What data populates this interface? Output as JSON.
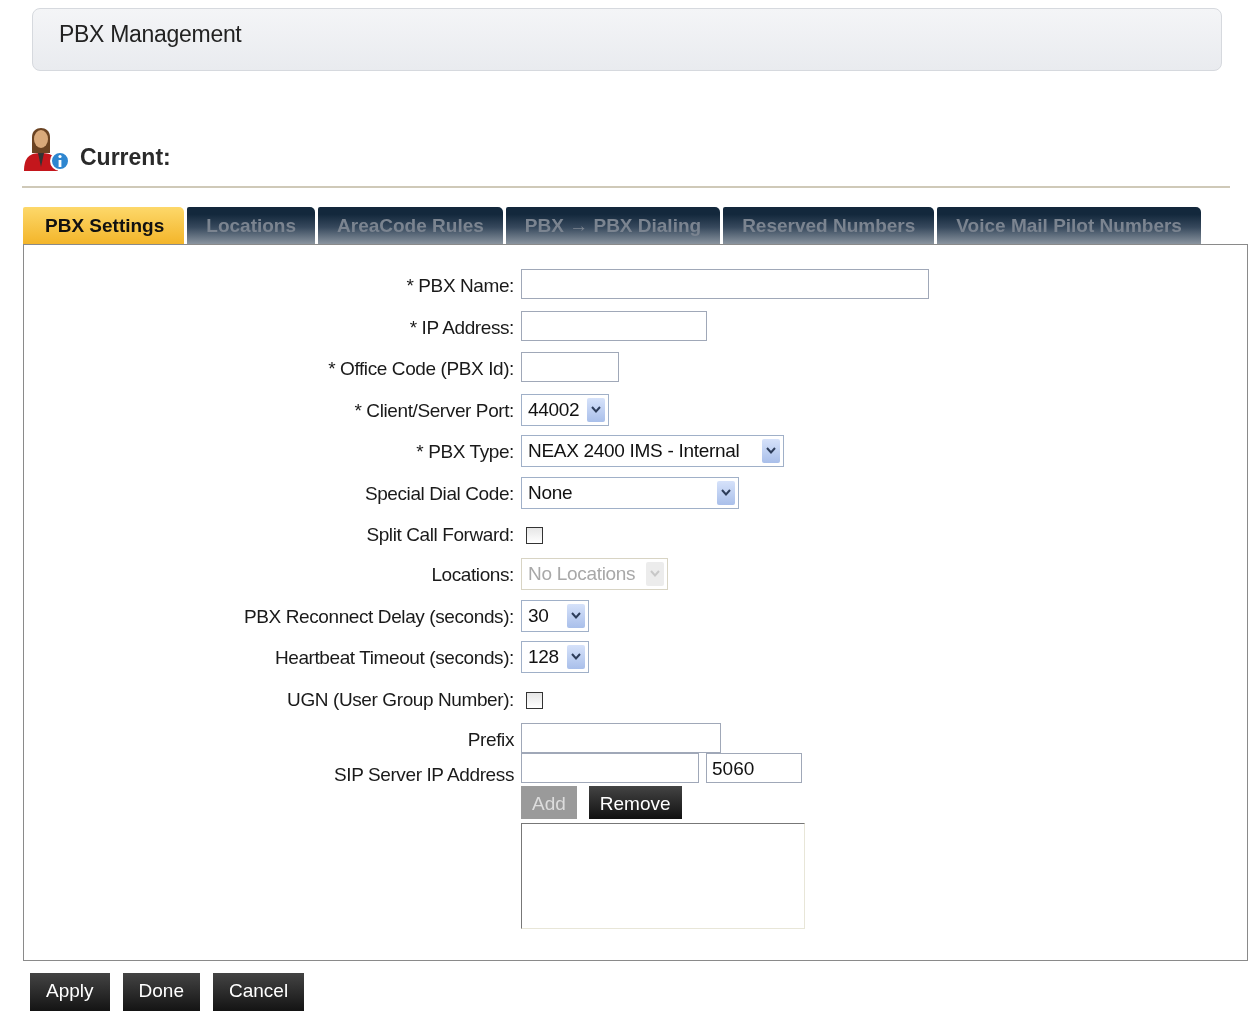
{
  "header": {
    "title": "PBX Management"
  },
  "section": {
    "title": "Current:"
  },
  "tabs": [
    {
      "label": "PBX Settings",
      "selected": true
    },
    {
      "label": "Locations",
      "selected": false
    },
    {
      "label": "AreaCode Rules",
      "selected": false
    },
    {
      "label": "PBX → PBX Dialing",
      "selected": false
    },
    {
      "label": "Reserved Numbers",
      "selected": false
    },
    {
      "label": "Voice Mail Pilot Numbers",
      "selected": false
    }
  ],
  "fields": [
    {
      "kind": "text",
      "label": "* PBX Name:"
    },
    {
      "kind": "text",
      "label": "* IP Address:"
    },
    {
      "kind": "text",
      "label": "* Office Code (PBX Id):"
    },
    {
      "kind": "select",
      "label": "* Client/Server Port:",
      "value": "44002",
      "disabled": false
    },
    {
      "kind": "select",
      "label": "* PBX Type:",
      "value": "NEAX 2400 IMS - Internal",
      "disabled": false
    },
    {
      "kind": "select",
      "label": "Special Dial Code:",
      "value": "None",
      "disabled": false
    },
    {
      "kind": "checkbox",
      "label": "Split Call Forward:",
      "checked": false
    },
    {
      "kind": "select",
      "label": "Locations:",
      "value": "No Locations",
      "disabled": true
    },
    {
      "kind": "select",
      "label": "PBX Reconnect Delay (seconds):",
      "value": "30",
      "disabled": false
    },
    {
      "kind": "select",
      "label": "Heartbeat Timeout (seconds):",
      "value": "128",
      "disabled": false
    },
    {
      "kind": "checkbox",
      "label": "UGN (User Group Number):",
      "checked": false
    },
    {
      "kind": "text",
      "label": "Prefix"
    },
    {
      "kind": "sip",
      "label": "SIP Server IP Address",
      "port": "5060",
      "buttons": [
        {
          "label": "Add",
          "disabled": true
        },
        {
          "label": "Remove",
          "disabled": false
        }
      ]
    }
  ],
  "actions": [
    {
      "label": "Apply"
    },
    {
      "label": "Done"
    },
    {
      "label": "Cancel"
    }
  ]
}
